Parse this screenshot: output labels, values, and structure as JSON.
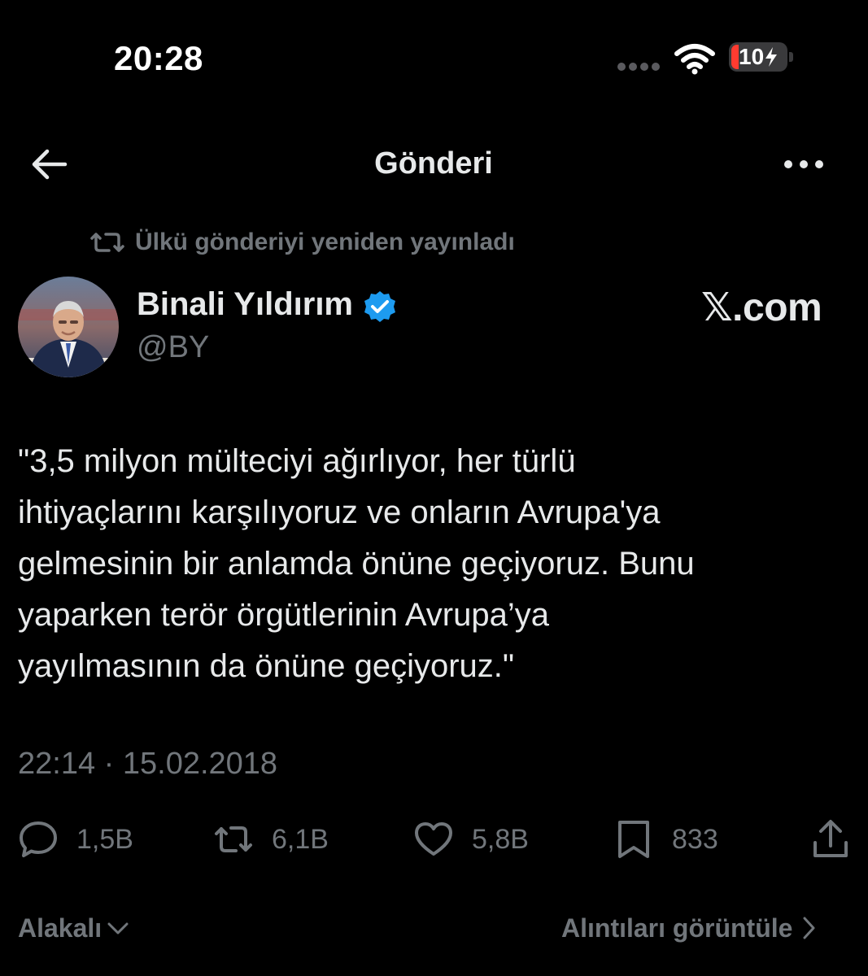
{
  "status_bar": {
    "time": "20:28",
    "battery_text": "10"
  },
  "header": {
    "title": "Gönderi"
  },
  "repost_notice": "Ülkü gönderiyi yeniden yayınladı",
  "author": {
    "name": "Binali Yıldırım",
    "handle": "@BY"
  },
  "watermark": "𝕏.com",
  "tweet": {
    "lines": [
      "\"3,5 milyon mülteciyi ağırlıyor, her türlü",
      "ihtiyaçlarını karşılıyoruz ve onların Avrupa'ya",
      "gelmesinin bir anlamda önüne geçiyoruz. Bunu",
      "yaparken terör örgütlerinin Avrupa’ya",
      "yayılmasının da önüne geçiyoruz.\""
    ],
    "timestamp": "22:14 · 15.02.2018"
  },
  "actions": {
    "replies": "1,5B",
    "reposts": "6,1B",
    "likes": "5,8B",
    "bookmarks": "833"
  },
  "footer": {
    "related": "Alakalı",
    "view_quotes": "Alıntıları görüntüle"
  },
  "colors": {
    "background": "#000000",
    "text": "#e7e9ea",
    "muted": "#71767b",
    "verified": "#1d9bf0",
    "battery_low": "#ff3b30"
  }
}
